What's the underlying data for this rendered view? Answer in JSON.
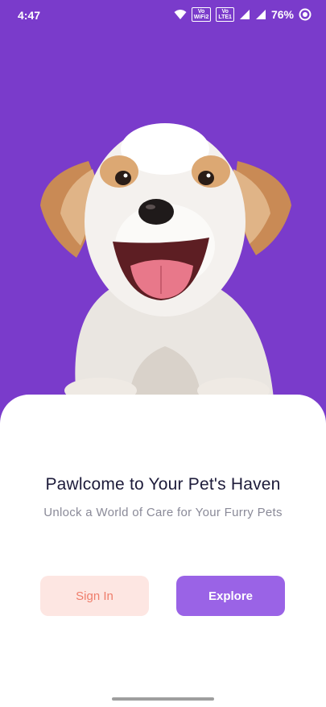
{
  "status_bar": {
    "time": "4:47",
    "battery": "76%",
    "tag1_top": "Vo",
    "tag1_bottom": "WiFi2",
    "tag2_top": "Vo",
    "tag2_bottom": "LTE1"
  },
  "welcome": {
    "title": "Pawlcome to Your Pet's Haven",
    "subtitle": "Unlock a World of Care for Your Furry Pets"
  },
  "actions": {
    "sign_in": "Sign In",
    "explore": "Explore"
  },
  "colors": {
    "hero_bg": "#7a3bcb",
    "primary": "#9a63e6",
    "sign_in_bg": "#fde6e2",
    "sign_in_text": "#ef7d6b"
  }
}
